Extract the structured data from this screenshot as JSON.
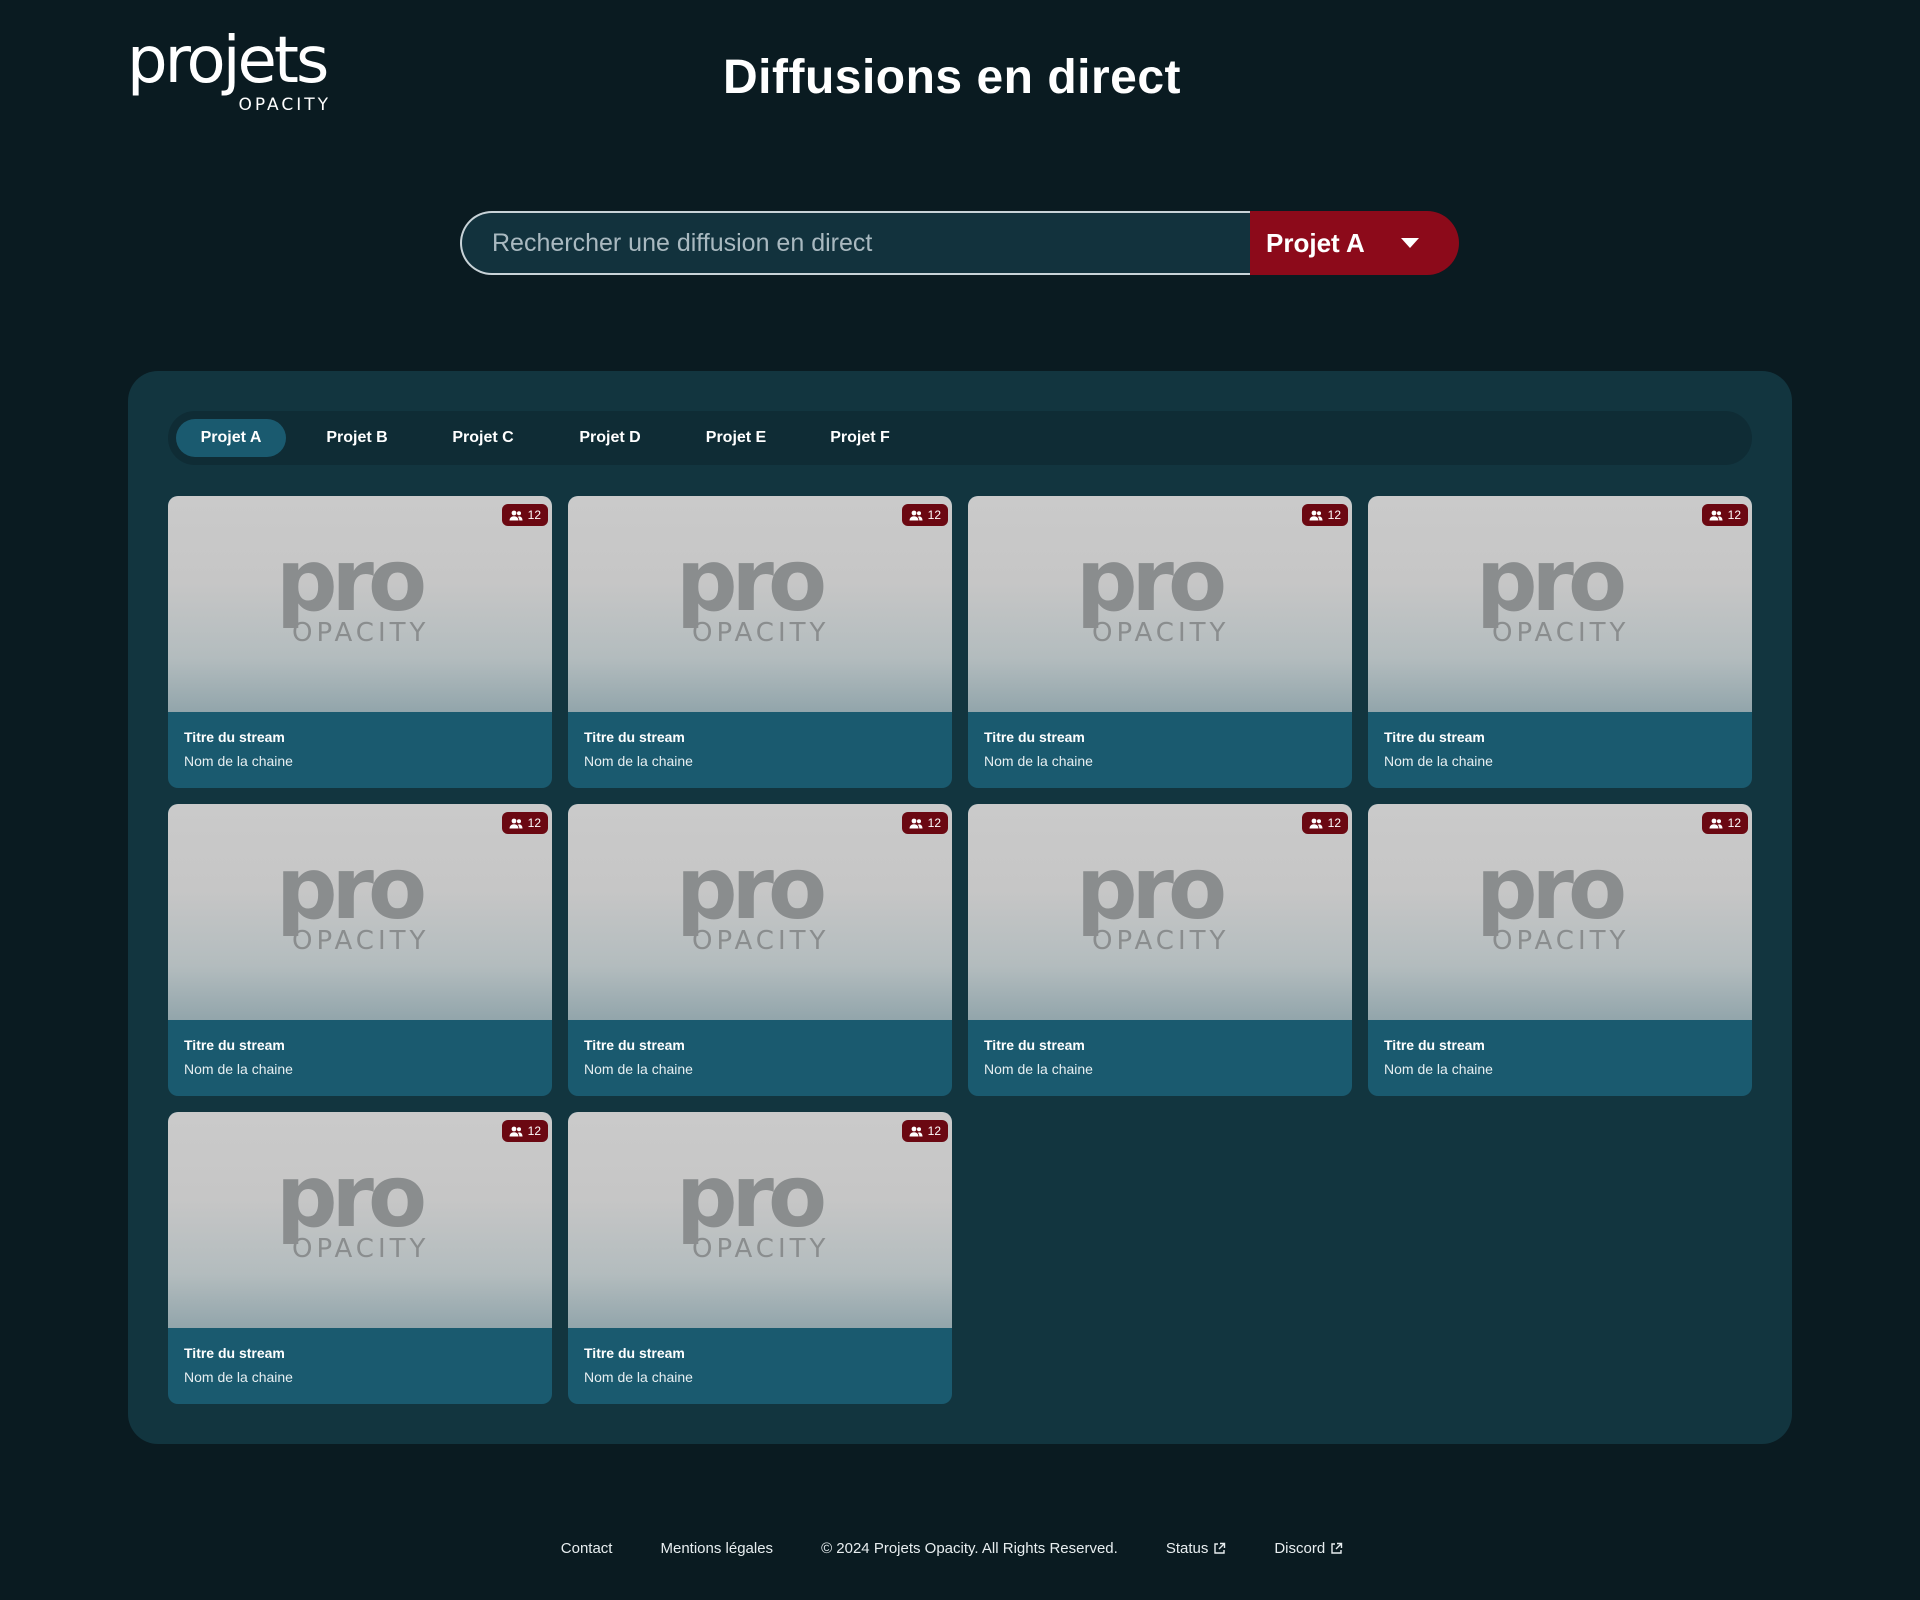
{
  "header": {
    "logo_word": "projets",
    "logo_sub": "OPACITY",
    "title": "Diffusions en direct"
  },
  "search": {
    "placeholder": "Rechercher une diffusion en direct",
    "value": "",
    "selected_project": "Projet A"
  },
  "tabs": [
    {
      "label": "Projet A",
      "active": true
    },
    {
      "label": "Projet B",
      "active": false
    },
    {
      "label": "Projet C",
      "active": false
    },
    {
      "label": "Projet D",
      "active": false
    },
    {
      "label": "Projet E",
      "active": false
    },
    {
      "label": "Projet F",
      "active": false
    }
  ],
  "thumbnail_logo": {
    "word": "pro",
    "sub": "OPACITY"
  },
  "streams": [
    {
      "title": "Titre du stream",
      "channel": "Nom de la chaine",
      "viewers": "12"
    },
    {
      "title": "Titre du stream",
      "channel": "Nom de la chaine",
      "viewers": "12"
    },
    {
      "title": "Titre du stream",
      "channel": "Nom de la chaine",
      "viewers": "12"
    },
    {
      "title": "Titre du stream",
      "channel": "Nom de la chaine",
      "viewers": "12"
    },
    {
      "title": "Titre du stream",
      "channel": "Nom de la chaine",
      "viewers": "12"
    },
    {
      "title": "Titre du stream",
      "channel": "Nom de la chaine",
      "viewers": "12"
    },
    {
      "title": "Titre du stream",
      "channel": "Nom de la chaine",
      "viewers": "12"
    },
    {
      "title": "Titre du stream",
      "channel": "Nom de la chaine",
      "viewers": "12"
    },
    {
      "title": "Titre du stream",
      "channel": "Nom de la chaine",
      "viewers": "12"
    },
    {
      "title": "Titre du stream",
      "channel": "Nom de la chaine",
      "viewers": "12"
    }
  ],
  "footer": {
    "contact": "Contact",
    "legal": "Mentions légales",
    "copyright": "© 2024 Projets Opacity. All Rights Reserved.",
    "status": "Status",
    "discord": "Discord"
  },
  "colors": {
    "background": "#0a1b21",
    "panel": "#12353f",
    "accent_red": "#8c0a1a",
    "card_info": "#1a5a6f"
  },
  "icons": {
    "viewers": "users-icon",
    "dropdown": "chevron-down-icon",
    "external_link": "external-link-icon"
  }
}
